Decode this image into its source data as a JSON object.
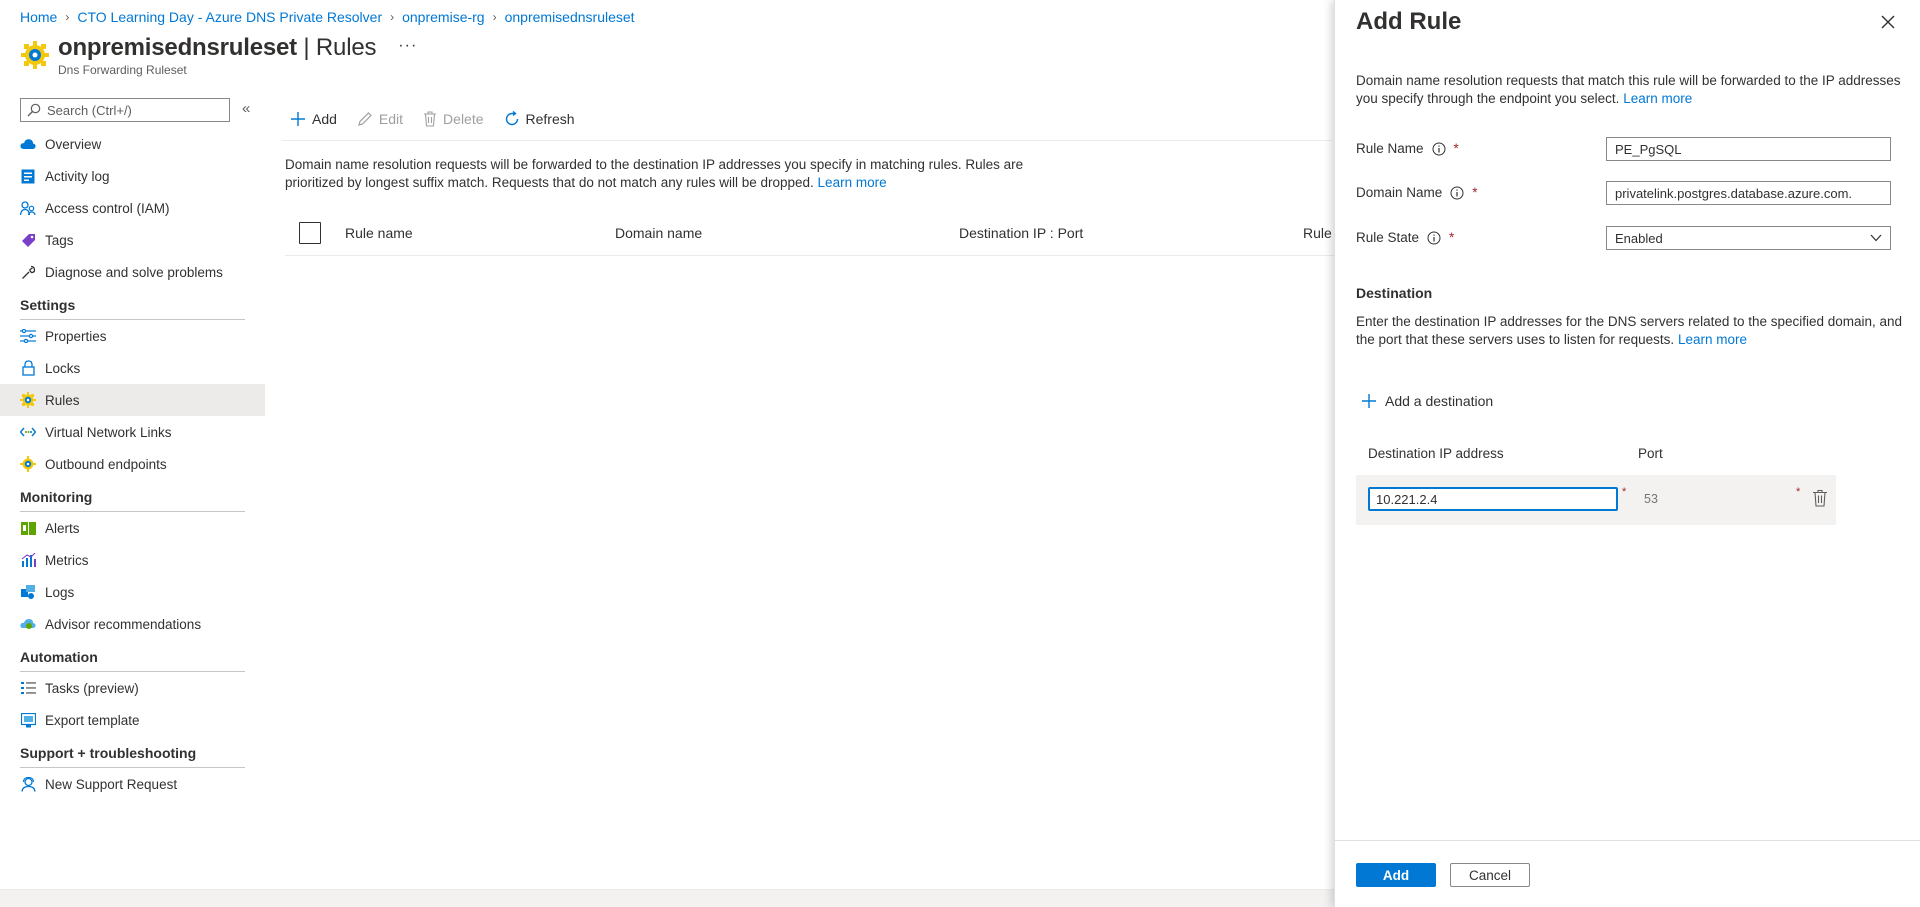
{
  "breadcrumb": {
    "home": "Home",
    "item1": "CTO Learning Day - Azure DNS Private Resolver",
    "item2": "onpremise-rg",
    "item3": "onpremisednsruleset"
  },
  "header": {
    "title_bold": "onpremisednsruleset",
    "title_rest": " | Rules",
    "more": "···",
    "subtitle": "Dns Forwarding Ruleset"
  },
  "sidebar": {
    "search_placeholder": "Search (Ctrl+/)",
    "collapse": "«",
    "items": {
      "overview": "Overview",
      "activity_log": "Activity log",
      "access_control": "Access control (IAM)",
      "tags": "Tags",
      "diagnose": "Diagnose and solve problems",
      "properties": "Properties",
      "locks": "Locks",
      "rules": "Rules",
      "vnet_links": "Virtual Network Links",
      "outbound": "Outbound endpoints",
      "alerts": "Alerts",
      "metrics": "Metrics",
      "logs": "Logs",
      "advisor": "Advisor recommendations",
      "tasks": "Tasks (preview)",
      "export": "Export template",
      "support": "New Support Request"
    },
    "groups": {
      "settings": "Settings",
      "monitoring": "Monitoring",
      "automation": "Automation",
      "support": "Support + troubleshooting"
    }
  },
  "toolbar": {
    "add": "Add",
    "edit": "Edit",
    "delete": "Delete",
    "refresh": "Refresh"
  },
  "main": {
    "description": "Domain name resolution requests will be forwarded to the destination IP addresses you specify in matching rules. Rules are prioritized by longest suffix match. Requests that do not match any rules will be dropped.",
    "learn_more": "Learn more",
    "columns": {
      "rule_name": "Rule name",
      "domain_name": "Domain name",
      "dest": "Destination IP : Port",
      "rule_state": "Rule s"
    }
  },
  "panel": {
    "title": "Add Rule",
    "description": "Domain name resolution requests that match this rule will be forwarded to the IP addresses you specify through the endpoint you select.",
    "learn_more": "Learn more",
    "rule_name_label": "Rule Name",
    "rule_name_value": "PE_PgSQL",
    "domain_name_label": "Domain Name",
    "domain_name_value": "privatelink.postgres.database.azure.com.",
    "rule_state_label": "Rule State",
    "rule_state_value": "Enabled",
    "required": "*",
    "destination_title": "Destination",
    "destination_desc": "Enter the destination IP addresses for the DNS servers related to the specified domain, and the port that these servers uses to listen for requests.",
    "destination_learn_more": "Learn more",
    "add_destination": "Add a destination",
    "col_ip": "Destination IP address",
    "col_port": "Port",
    "row_ip": "10.221.2.4",
    "row_port_placeholder": "53",
    "add_button": "Add",
    "cancel_button": "Cancel"
  },
  "colors": {
    "accent": "#0078d4",
    "required": "#a4262c",
    "selected_nav": "#edebe9"
  }
}
